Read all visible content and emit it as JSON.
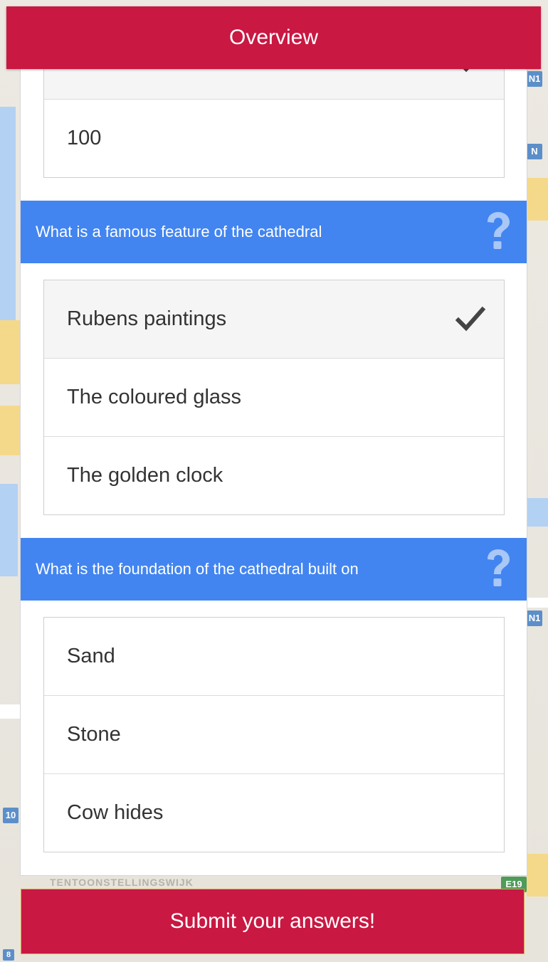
{
  "header": {
    "title": "Overview"
  },
  "map": {
    "labels": [
      "TENTOONSTELLINGSWIJK"
    ],
    "shields": [
      "N1",
      "N",
      "E19",
      "10",
      "8"
    ]
  },
  "question_prev": {
    "options": [
      {
        "label": "",
        "selected": true
      },
      {
        "label": "100",
        "selected": false
      }
    ]
  },
  "question_feature": {
    "text": "What is a famous feature of the cathedral",
    "help_icon": "question-mark-icon",
    "options": [
      {
        "label": "Rubens paintings",
        "selected": true
      },
      {
        "label": "The coloured glass",
        "selected": false
      },
      {
        "label": "The golden clock",
        "selected": false
      }
    ]
  },
  "question_foundation": {
    "text": "What is the foundation of the cathedral built on",
    "help_icon": "question-mark-icon",
    "options": [
      {
        "label": "Sand",
        "selected": false
      },
      {
        "label": "Stone",
        "selected": false
      },
      {
        "label": "Cow hides",
        "selected": false
      }
    ]
  },
  "submit": {
    "label": "Submit your answers!"
  },
  "colors": {
    "header_bg": "#c91842",
    "question_bg": "#4285f0",
    "help_icon": "#a9c7f7",
    "check": "#444444"
  }
}
